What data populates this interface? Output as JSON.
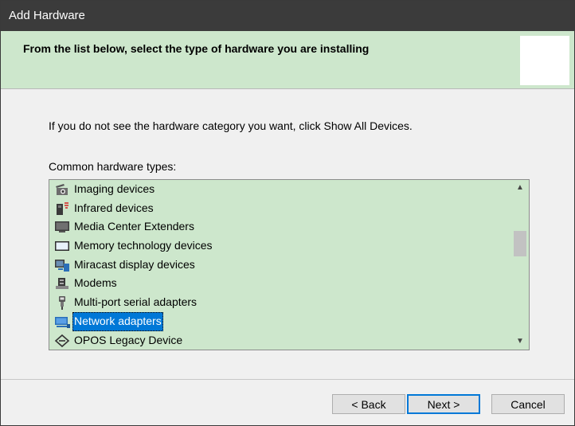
{
  "window": {
    "title": "Add Hardware"
  },
  "header": {
    "heading": "From the list below, select the type of hardware you are installing"
  },
  "body": {
    "hint": "If you do not see the hardware category you want, click Show All Devices.",
    "list_label": "Common hardware types:"
  },
  "list": {
    "items": [
      {
        "label": "Imaging devices",
        "icon": "camera-icon"
      },
      {
        "label": "Infrared devices",
        "icon": "infrared-icon"
      },
      {
        "label": "Media Center Extenders",
        "icon": "monitor-icon"
      },
      {
        "label": "Memory technology devices",
        "icon": "memory-card-icon"
      },
      {
        "label": "Miracast display devices",
        "icon": "miracast-icon"
      },
      {
        "label": "Modems",
        "icon": "modem-icon"
      },
      {
        "label": "Multi-port serial adapters",
        "icon": "serial-port-icon"
      },
      {
        "label": "Network adapters",
        "icon": "network-adapter-icon",
        "selected": true
      },
      {
        "label": "OPOS Legacy Device",
        "icon": "opos-device-icon"
      }
    ]
  },
  "buttons": {
    "back": "< Back",
    "next": "Next >",
    "cancel": "Cancel"
  },
  "colors": {
    "header_bg": "#cde7cc",
    "titlebar_bg": "#3b3b3b",
    "selection": "#0078d7"
  }
}
